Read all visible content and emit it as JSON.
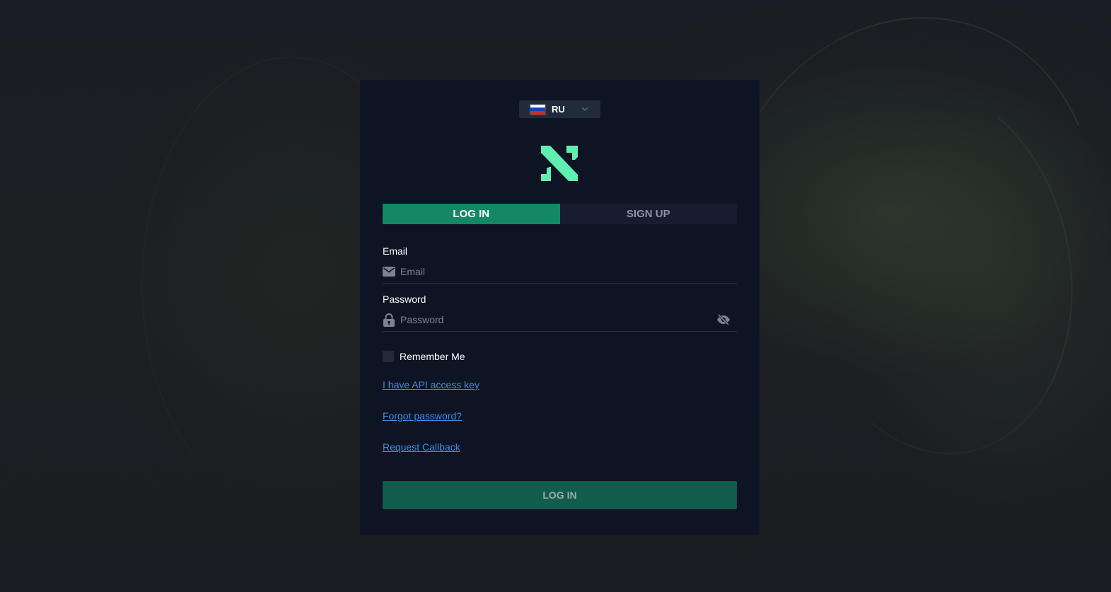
{
  "language": {
    "code": "RU",
    "flag_colors": [
      "#ffffff",
      "#1b3fb3",
      "#d52b1e"
    ]
  },
  "logo": {
    "icon": "nakedb-logo-icon",
    "color": "#5ff0b0"
  },
  "tabs": [
    {
      "label": "LOG IN",
      "active": true
    },
    {
      "label": "SIGN UP",
      "active": false
    }
  ],
  "form": {
    "email": {
      "label": "Email",
      "placeholder": "Email",
      "value": "",
      "icon": "envelope-icon"
    },
    "password": {
      "label": "Password",
      "placeholder": "Password",
      "value": "",
      "icon": "lock-icon",
      "toggle_icon": "eye-off-icon"
    },
    "remember": {
      "label": "Remember Me",
      "checked": false
    }
  },
  "links": {
    "api_key": "I have API access key",
    "forgot": "Forgot password?",
    "callback": "Request Callback"
  },
  "submit_label": "LOG IN",
  "colors": {
    "accent": "#138863",
    "submit_bg": "#115c4d",
    "link": "#3f8de3",
    "card_bg": "#0e1423"
  }
}
